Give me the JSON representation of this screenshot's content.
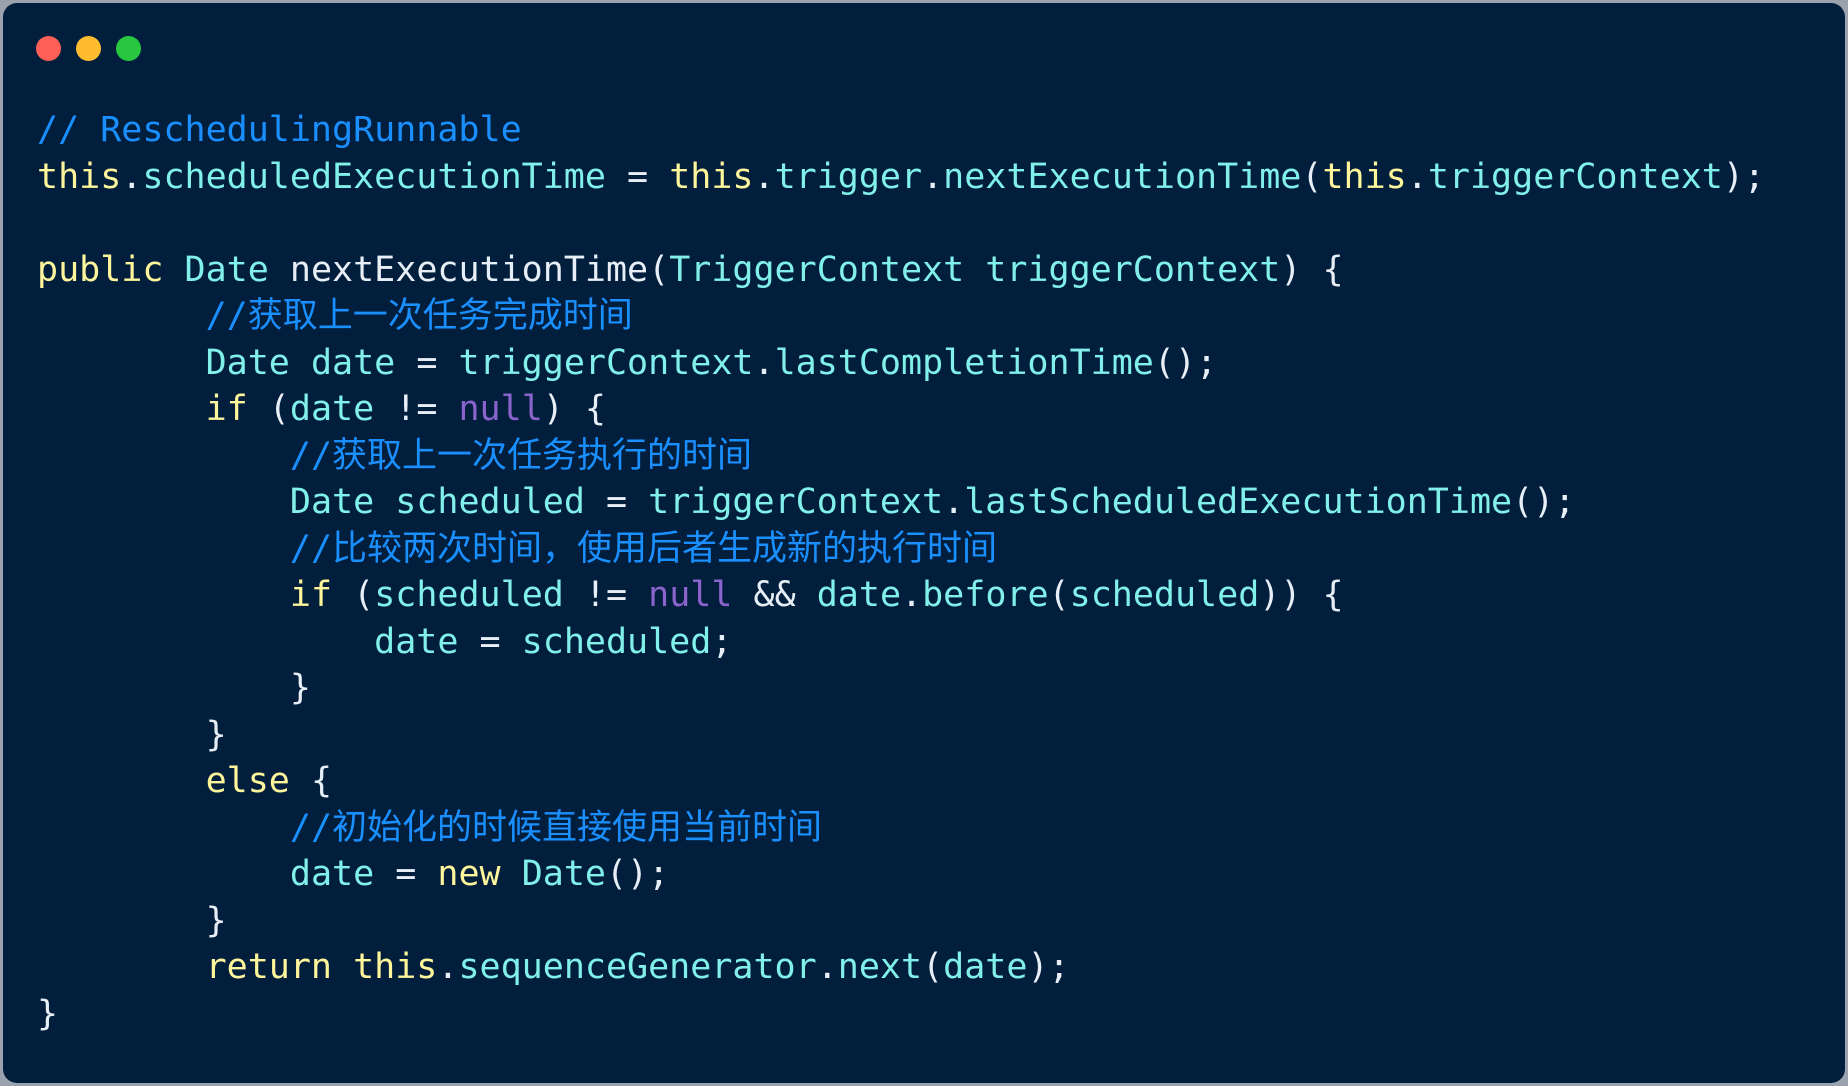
{
  "window": {
    "controls": [
      "close",
      "minimize",
      "zoom"
    ],
    "colors": {
      "background": "#011f3d",
      "close": "#fe5f57",
      "minimize": "#febc2e",
      "zoom": "#27c840"
    }
  },
  "code": {
    "language": "java",
    "lines": [
      [
        {
          "k": "cmt",
          "t": "// ReschedulingRunnable"
        }
      ],
      [
        {
          "k": "kw",
          "t": "this"
        },
        {
          "k": "pl",
          "t": "."
        },
        {
          "k": "id",
          "t": "scheduledExecutionTime"
        },
        {
          "k": "pl",
          "t": " = "
        },
        {
          "k": "kw",
          "t": "this"
        },
        {
          "k": "pl",
          "t": "."
        },
        {
          "k": "id",
          "t": "trigger"
        },
        {
          "k": "pl",
          "t": "."
        },
        {
          "k": "id",
          "t": "nextExecutionTime"
        },
        {
          "k": "pl",
          "t": "("
        },
        {
          "k": "kw",
          "t": "this"
        },
        {
          "k": "pl",
          "t": "."
        },
        {
          "k": "id",
          "t": "triggerContext"
        },
        {
          "k": "pl",
          "t": ");"
        }
      ],
      [],
      [
        {
          "k": "kw",
          "t": "public"
        },
        {
          "k": "pl",
          "t": " "
        },
        {
          "k": "ty",
          "t": "Date"
        },
        {
          "k": "pl",
          "t": " nextExecutionTime("
        },
        {
          "k": "ty",
          "t": "TriggerContext"
        },
        {
          "k": "pl",
          "t": " "
        },
        {
          "k": "id",
          "t": "triggerContext"
        },
        {
          "k": "pl",
          "t": ") {"
        }
      ],
      [
        {
          "k": "pl",
          "t": "        "
        },
        {
          "k": "cmt",
          "t": "//获取上一次任务完成时间"
        }
      ],
      [
        {
          "k": "pl",
          "t": "        "
        },
        {
          "k": "ty",
          "t": "Date"
        },
        {
          "k": "pl",
          "t": " "
        },
        {
          "k": "id",
          "t": "date"
        },
        {
          "k": "pl",
          "t": " = "
        },
        {
          "k": "id",
          "t": "triggerContext"
        },
        {
          "k": "pl",
          "t": "."
        },
        {
          "k": "id",
          "t": "lastCompletionTime"
        },
        {
          "k": "pl",
          "t": "();"
        }
      ],
      [
        {
          "k": "pl",
          "t": "        "
        },
        {
          "k": "kw",
          "t": "if"
        },
        {
          "k": "pl",
          "t": " ("
        },
        {
          "k": "id",
          "t": "date"
        },
        {
          "k": "pl",
          "t": " != "
        },
        {
          "k": "nl",
          "t": "null"
        },
        {
          "k": "pl",
          "t": ") {"
        }
      ],
      [
        {
          "k": "pl",
          "t": "            "
        },
        {
          "k": "cmt",
          "t": "//获取上一次任务执行的时间"
        }
      ],
      [
        {
          "k": "pl",
          "t": "            "
        },
        {
          "k": "ty",
          "t": "Date"
        },
        {
          "k": "pl",
          "t": " "
        },
        {
          "k": "id",
          "t": "scheduled"
        },
        {
          "k": "pl",
          "t": " = "
        },
        {
          "k": "id",
          "t": "triggerContext"
        },
        {
          "k": "pl",
          "t": "."
        },
        {
          "k": "id",
          "t": "lastScheduledExecutionTime"
        },
        {
          "k": "pl",
          "t": "();"
        }
      ],
      [
        {
          "k": "pl",
          "t": "            "
        },
        {
          "k": "cmt",
          "t": "//比较两次时间，使用后者生成新的执行时间"
        }
      ],
      [
        {
          "k": "pl",
          "t": "            "
        },
        {
          "k": "kw",
          "t": "if"
        },
        {
          "k": "pl",
          "t": " ("
        },
        {
          "k": "id",
          "t": "scheduled"
        },
        {
          "k": "pl",
          "t": " != "
        },
        {
          "k": "nl",
          "t": "null"
        },
        {
          "k": "pl",
          "t": " && "
        },
        {
          "k": "id",
          "t": "date"
        },
        {
          "k": "pl",
          "t": "."
        },
        {
          "k": "id",
          "t": "before"
        },
        {
          "k": "pl",
          "t": "("
        },
        {
          "k": "id",
          "t": "scheduled"
        },
        {
          "k": "pl",
          "t": ")) {"
        }
      ],
      [
        {
          "k": "pl",
          "t": "                "
        },
        {
          "k": "id",
          "t": "date"
        },
        {
          "k": "pl",
          "t": " = "
        },
        {
          "k": "id",
          "t": "scheduled"
        },
        {
          "k": "pl",
          "t": ";"
        }
      ],
      [
        {
          "k": "pl",
          "t": "            }"
        }
      ],
      [
        {
          "k": "pl",
          "t": "        }"
        }
      ],
      [
        {
          "k": "pl",
          "t": "        "
        },
        {
          "k": "kw",
          "t": "else"
        },
        {
          "k": "pl",
          "t": " {"
        }
      ],
      [
        {
          "k": "pl",
          "t": "            "
        },
        {
          "k": "cmt",
          "t": "//初始化的时候直接使用当前时间"
        }
      ],
      [
        {
          "k": "pl",
          "t": "            "
        },
        {
          "k": "id",
          "t": "date"
        },
        {
          "k": "pl",
          "t": " = "
        },
        {
          "k": "kw",
          "t": "new"
        },
        {
          "k": "pl",
          "t": " "
        },
        {
          "k": "ty",
          "t": "Date"
        },
        {
          "k": "pl",
          "t": "();"
        }
      ],
      [
        {
          "k": "pl",
          "t": "        }"
        }
      ],
      [
        {
          "k": "pl",
          "t": "        "
        },
        {
          "k": "kw",
          "t": "return"
        },
        {
          "k": "pl",
          "t": " "
        },
        {
          "k": "kw",
          "t": "this"
        },
        {
          "k": "pl",
          "t": "."
        },
        {
          "k": "id",
          "t": "sequenceGenerator"
        },
        {
          "k": "pl",
          "t": "."
        },
        {
          "k": "id",
          "t": "next"
        },
        {
          "k": "pl",
          "t": "("
        },
        {
          "k": "id",
          "t": "date"
        },
        {
          "k": "pl",
          "t": ");"
        }
      ],
      [
        {
          "k": "pl",
          "t": "}"
        }
      ]
    ]
  }
}
